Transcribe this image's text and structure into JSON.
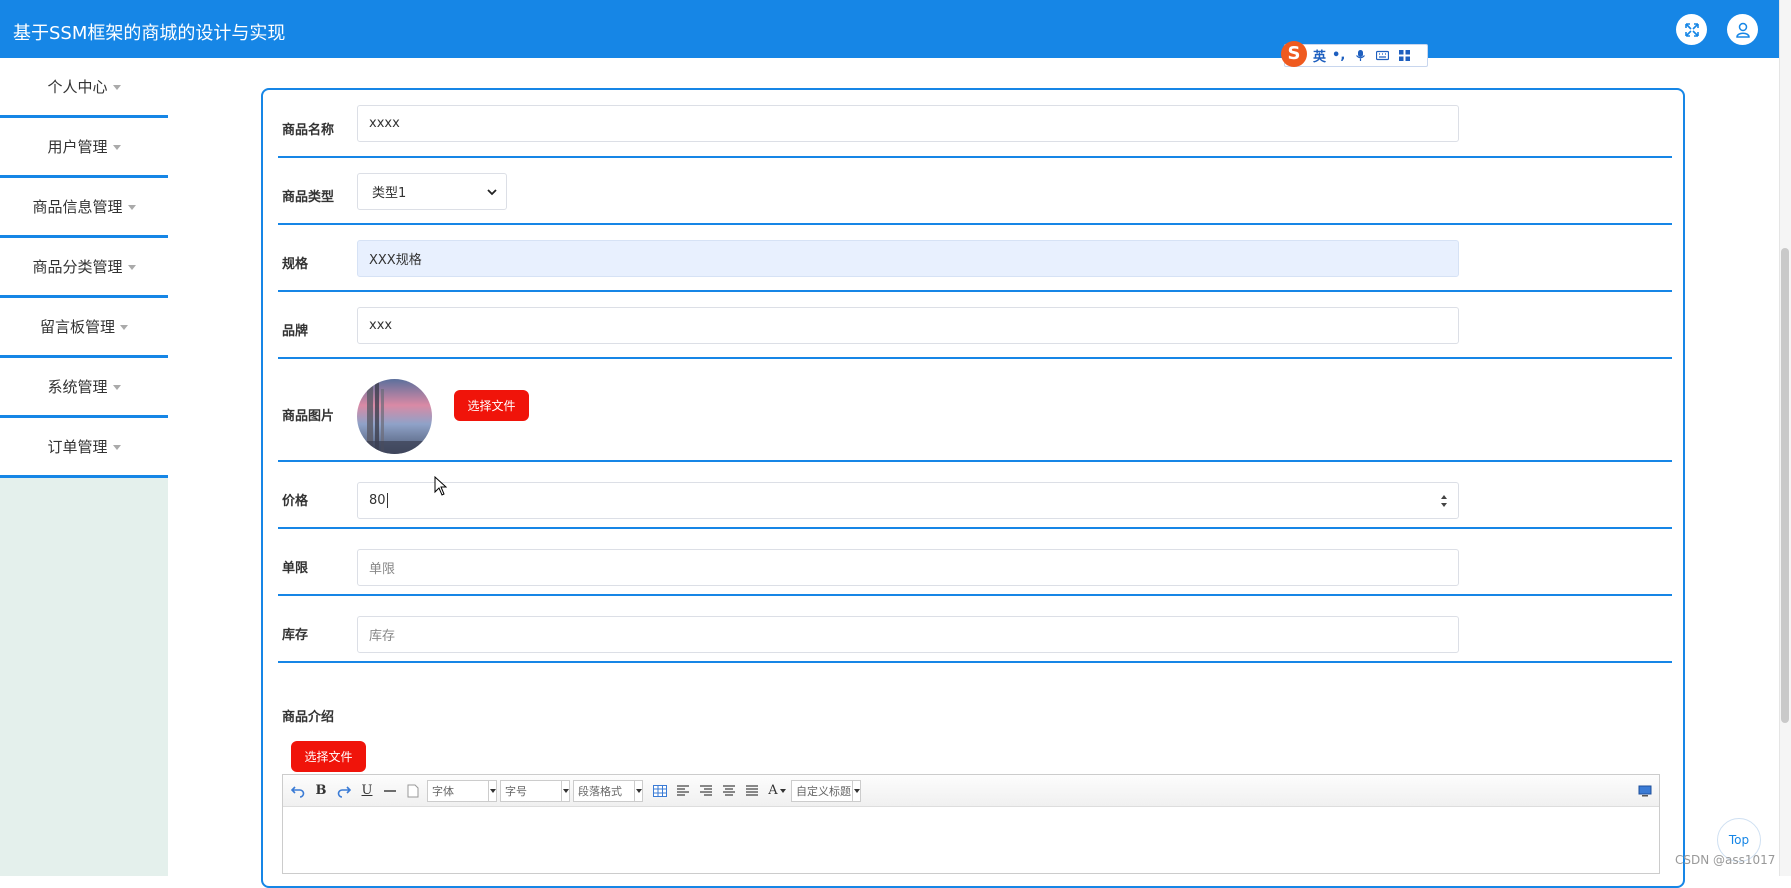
{
  "header": {
    "title": "基于SSM框架的商城的设计与实现",
    "fullscreen_icon": "expand-icon",
    "user_icon": "user-icon",
    "bg_color": "#1686e6"
  },
  "ime": {
    "logo": "S",
    "mode": "英",
    "punct": "•,",
    "icons": [
      "mic-icon",
      "keyboard-icon",
      "grid-icon"
    ]
  },
  "sidebar": {
    "items": [
      {
        "label": "个人中心"
      },
      {
        "label": "用户管理"
      },
      {
        "label": "商品信息管理"
      },
      {
        "label": "商品分类管理"
      },
      {
        "label": "留言板管理"
      },
      {
        "label": "系统管理"
      },
      {
        "label": "订单管理"
      }
    ]
  },
  "form": {
    "name": {
      "label": "商品名称",
      "value": "xxxx"
    },
    "type": {
      "label": "商品类型",
      "value": "类型1",
      "options": [
        "类型1"
      ]
    },
    "spec": {
      "label": "规格",
      "value": "XXX规格"
    },
    "brand": {
      "label": "品牌",
      "value": "xxx"
    },
    "image": {
      "label": "商品图片",
      "button": "选择文件"
    },
    "price": {
      "label": "价格",
      "value": "80"
    },
    "limit": {
      "label": "单限",
      "placeholder": "单限"
    },
    "stock": {
      "label": "库存",
      "placeholder": "库存"
    },
    "intro": {
      "label": "商品介绍",
      "button": "选择文件"
    }
  },
  "editor": {
    "font_family": "字体",
    "font_size": "字号",
    "paragraph": "段落格式",
    "custom_title": "自定义标题"
  },
  "top_button": "Top",
  "watermark": "CSDN @ass1017",
  "accent_color": "#1686e6",
  "danger_color": "#f0140a"
}
